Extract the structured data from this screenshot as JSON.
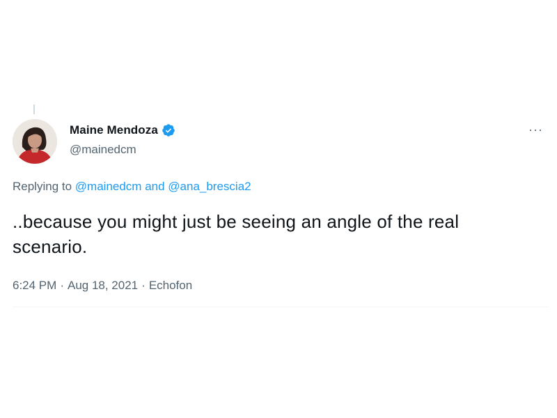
{
  "tweet": {
    "author": {
      "display_name": "Maine Mendoza",
      "handle": "@mainedcm",
      "verified_icon": "verified-badge-icon",
      "avatar": "avatar-photo"
    },
    "more_label": "···",
    "reply": {
      "prefix": "Replying to ",
      "mention_1": "@mainedcm",
      "conjunction": " and ",
      "mention_2": "@ana_brescia2"
    },
    "text_line_1": "..because you might just be seeing an angle of the real",
    "text_line_2": "scenario.",
    "meta": {
      "time": "6:24 PM",
      "separator": "·",
      "date": "Aug 18, 2021",
      "source": "Echofon"
    }
  },
  "colors": {
    "text": "#0f1419",
    "secondary": "#536471",
    "link": "#1d9bf0",
    "verified": "#1d9bf0"
  }
}
